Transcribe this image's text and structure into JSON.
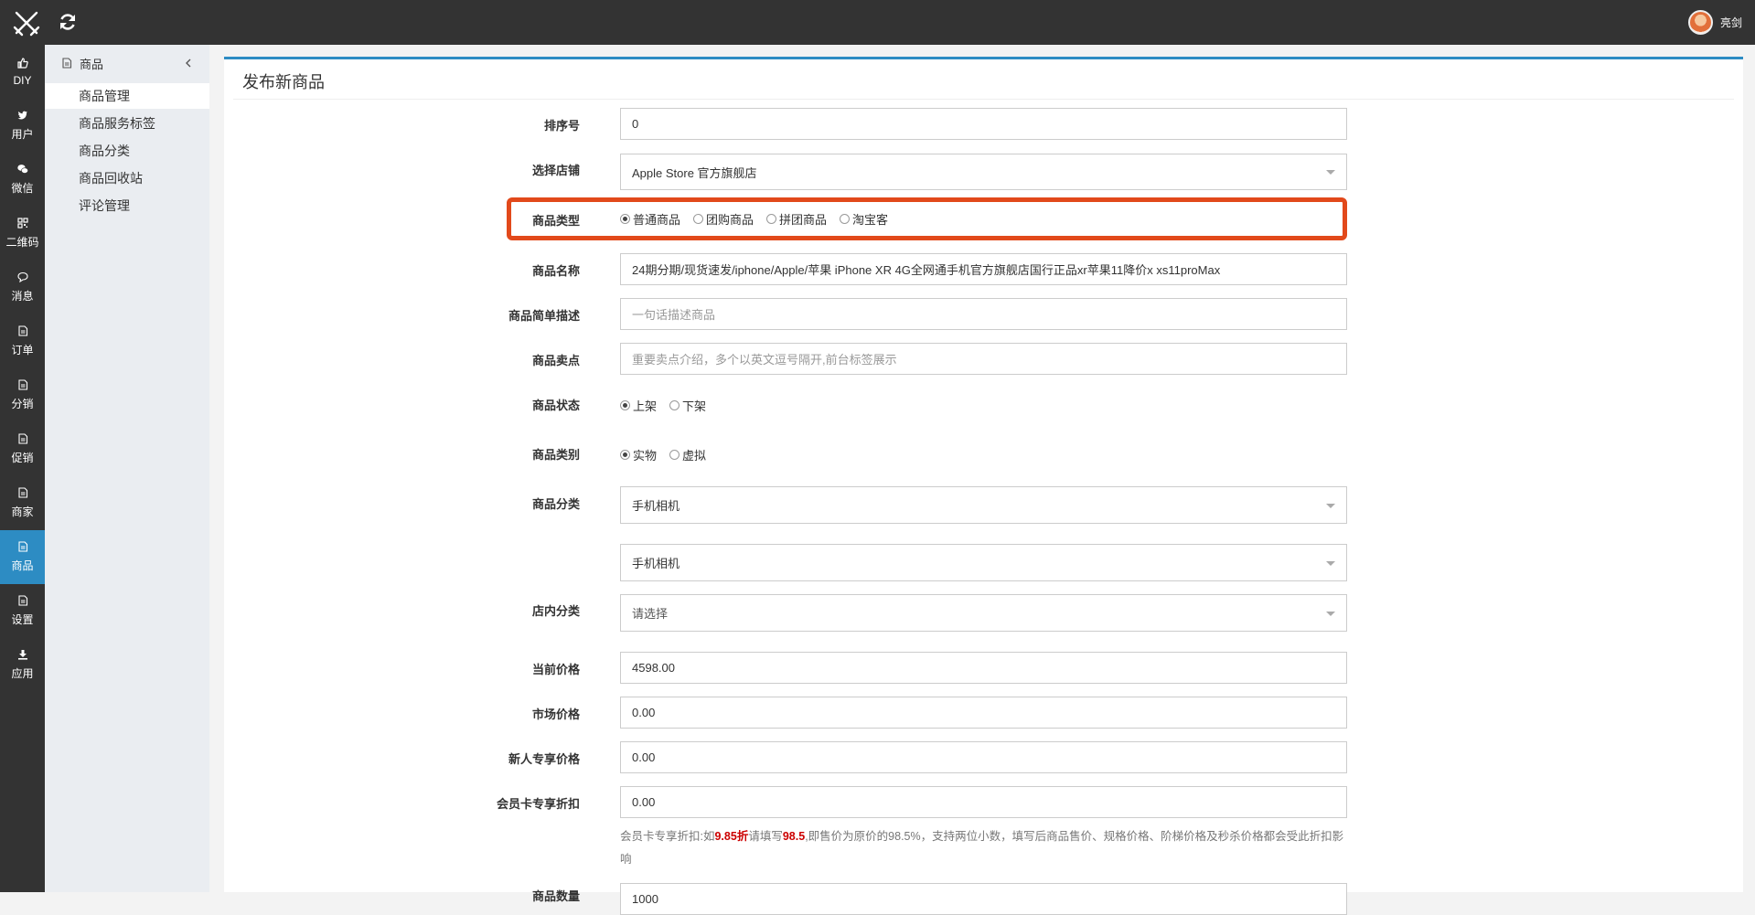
{
  "topbar": {
    "user_name": "亮剑"
  },
  "leftnav": [
    {
      "label": "DIY",
      "icon": "thumbs-up-icon"
    },
    {
      "label": "用户",
      "icon": "twitter-bird-icon"
    },
    {
      "label": "微信",
      "icon": "wechat-icon"
    },
    {
      "label": "二维码",
      "icon": "qrcode-icon"
    },
    {
      "label": "消息",
      "icon": "chat-bubble-icon"
    },
    {
      "label": "订单",
      "icon": "document-icon"
    },
    {
      "label": "分销",
      "icon": "document-icon"
    },
    {
      "label": "促销",
      "icon": "document-icon"
    },
    {
      "label": "商家",
      "icon": "document-icon"
    },
    {
      "label": "商品",
      "icon": "document-icon",
      "active": true
    },
    {
      "label": "设置",
      "icon": "document-icon"
    },
    {
      "label": "应用",
      "icon": "download-icon"
    }
  ],
  "subnav": {
    "header": "商品",
    "items": [
      "商品管理",
      "商品服务标签",
      "商品分类",
      "商品回收站",
      "评论管理"
    ],
    "active_index": 0
  },
  "page": {
    "title": "发布新商品"
  },
  "form": {
    "sort": {
      "label": "排序号",
      "value": "0"
    },
    "store": {
      "label": "选择店铺",
      "value": "Apple Store 官方旗舰店"
    },
    "goods_type": {
      "label": "商品类型",
      "options": [
        "普通商品",
        "团购商品",
        "拼团商品",
        "淘宝客"
      ],
      "selected": 0
    },
    "name": {
      "label": "商品名称",
      "value": "24期分期/现货速发/iphone/Apple/苹果 iPhone XR 4G全网通手机官方旗舰店国行正品xr苹果11降价x xs11proMax"
    },
    "brief": {
      "label": "商品简单描述",
      "placeholder": "一句话描述商品"
    },
    "selling_points": {
      "label": "商品卖点",
      "placeholder": "重要卖点介绍，多个以英文逗号隔开,前台标签展示"
    },
    "status": {
      "label": "商品状态",
      "options": [
        "上架",
        "下架"
      ],
      "selected": 0
    },
    "kind": {
      "label": "商品类别",
      "options": [
        "实物",
        "虚拟"
      ],
      "selected": 0
    },
    "category": {
      "label": "商品分类",
      "value1": "手机相机",
      "value2": "手机相机"
    },
    "shop_category": {
      "label": "店内分类",
      "value": "请选择"
    },
    "current_price": {
      "label": "当前价格",
      "value": "4598.00"
    },
    "market_price": {
      "label": "市场价格",
      "value": "0.00"
    },
    "newcomer_price": {
      "label": "新人专享价格",
      "value": "0.00"
    },
    "member_discount": {
      "label": "会员卡专享折扣",
      "value": "0.00",
      "help_prefix": "会员卡专享折扣:如",
      "help_red1": "9.85折",
      "help_mid": "请填写",
      "help_red2": "98.5",
      "help_suffix": ",即售价为原价的98.5%，支持两位小数，填写后商品售价、规格价格、阶梯价格及秒杀价格都会受此折扣影响"
    },
    "stock": {
      "label": "商品数量",
      "value": "1000"
    }
  },
  "colors": {
    "topbar": "#333333",
    "accent": "#2d8cc3",
    "highlight": "#e2491b"
  }
}
